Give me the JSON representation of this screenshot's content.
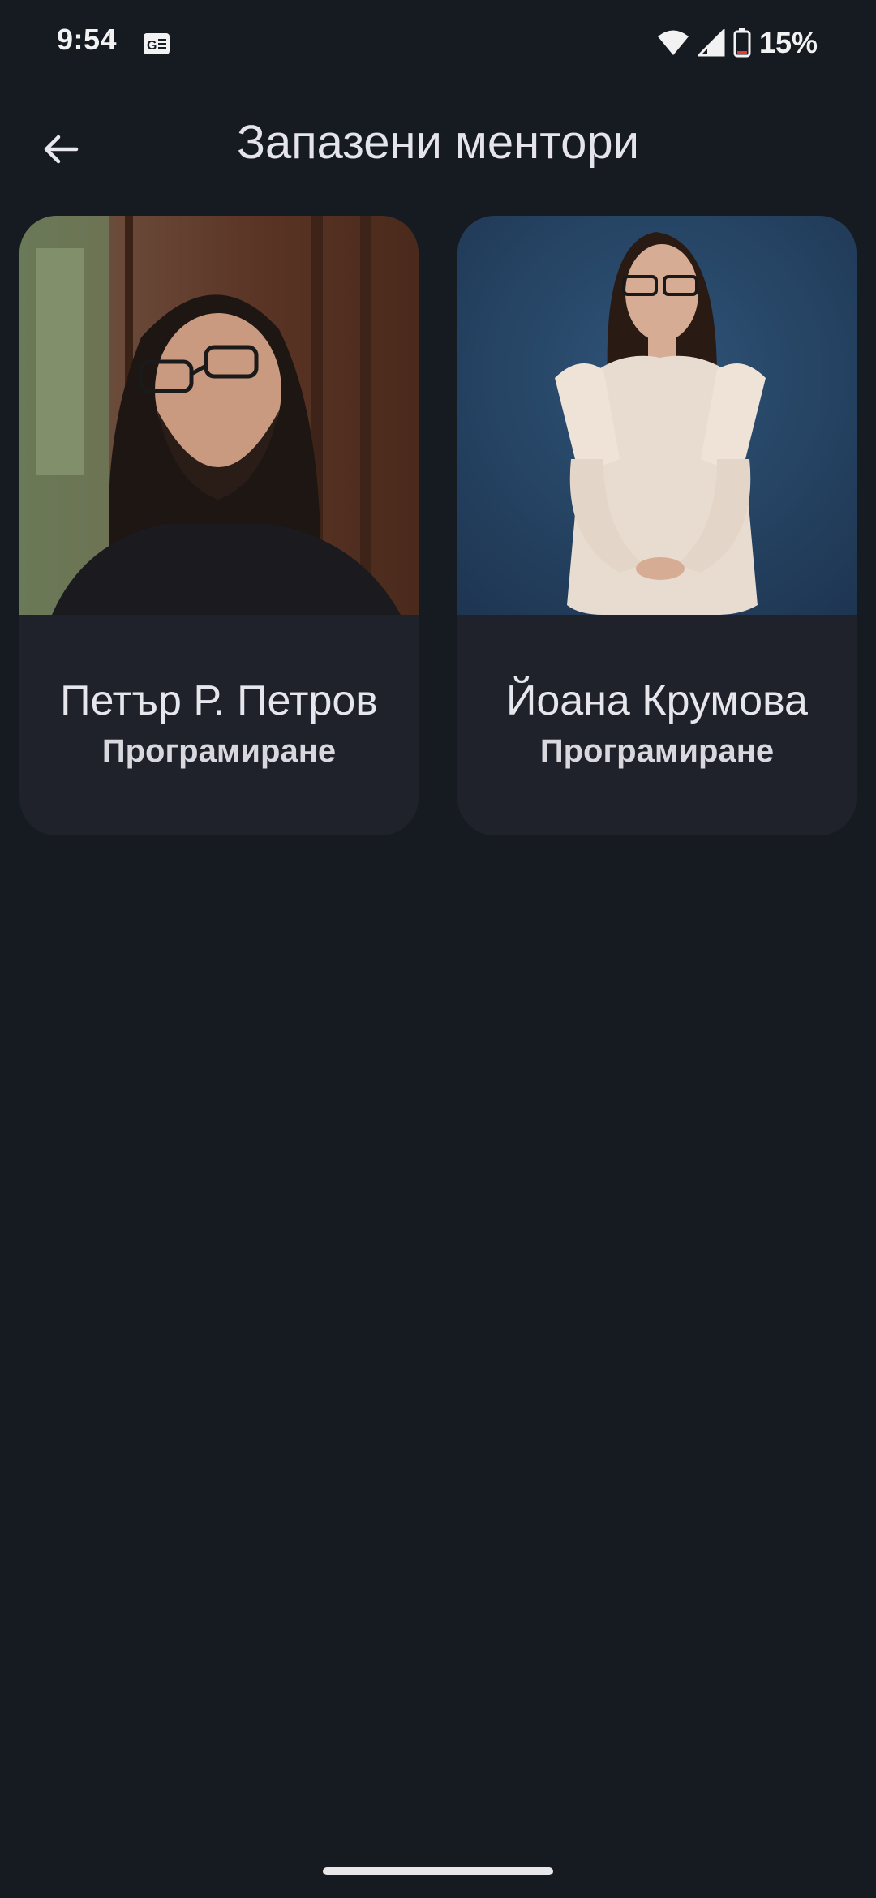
{
  "status_bar": {
    "time": "9:54",
    "battery_percent": "15%",
    "battery_level": 0.15,
    "icons": [
      "notification-icon",
      "wifi-icon",
      "cell-signal-icon",
      "battery-icon"
    ]
  },
  "app_bar": {
    "title": "Запазени ментори",
    "back_icon": "arrow-back-icon"
  },
  "mentors": [
    {
      "name": "Петър Р. Петров",
      "field": "Програмиране"
    },
    {
      "name": "Йоана Крумова",
      "field": "Програмиране"
    }
  ],
  "colors": {
    "background": "#161b22",
    "card": "#1f222b",
    "text": "#e6e6ec"
  }
}
